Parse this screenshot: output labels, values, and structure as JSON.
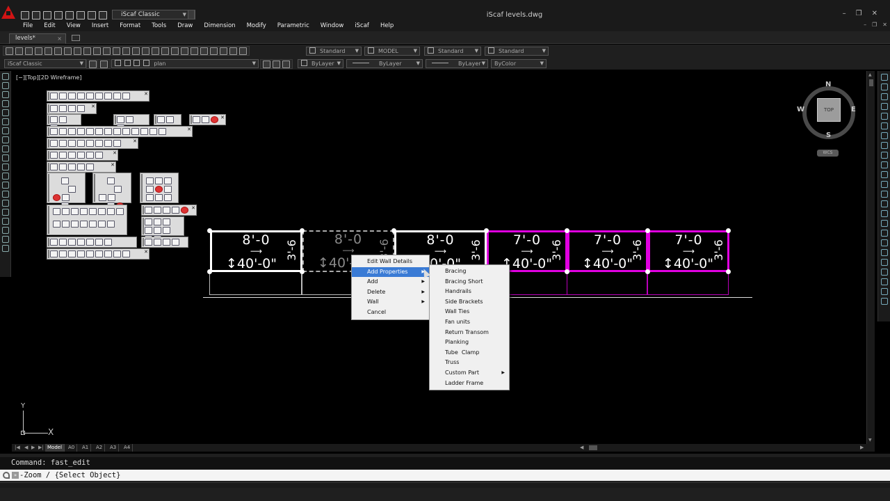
{
  "window": {
    "title": "iScaf   levels.dwg",
    "minimize": "–",
    "restore": "❐",
    "close": "✕"
  },
  "workspace": {
    "selected": "iScaf Classic"
  },
  "menu": [
    "File",
    "Edit",
    "View",
    "Insert",
    "Format",
    "Tools",
    "Draw",
    "Dimension",
    "Modify",
    "Parametric",
    "Window",
    "iScaf",
    "Help"
  ],
  "doc_controls": {
    "minimize": "–",
    "restore": "❐",
    "close": "✕"
  },
  "document_tab": {
    "label": "levels*",
    "close": "×"
  },
  "toolbar": {
    "text_style": "Standard",
    "dim_style": "MODEL",
    "table_style": "Standard",
    "multileader_style": "Standard",
    "workspace2": "iScaf Classic",
    "layer": "plan",
    "color": "ByLayer",
    "linetype": "ByLayer",
    "lineweight": "ByLayer",
    "plotstyle": "ByColor"
  },
  "viewport": {
    "label": "[−][Top][2D Wireframe]"
  },
  "viewcube": {
    "n": "N",
    "s": "S",
    "e": "E",
    "w": "W",
    "face": "TOP",
    "wcs": "WCS"
  },
  "ucs": {
    "x": "X",
    "y": "Y"
  },
  "drawing": {
    "panels": [
      {
        "height": "8'-0",
        "length": "40'-0\"",
        "lift": "3'-6"
      },
      {
        "height": "8'-0",
        "length": "40'-0\"",
        "lift": "3'-6"
      },
      {
        "height": "8'-0",
        "length": "40'-0\"",
        "lift": "3'-6"
      },
      {
        "height": "7'-0",
        "length": "40'-0\"",
        "lift": "3'-6"
      },
      {
        "height": "7'-0",
        "length": "40'-0\"",
        "lift": "3'-6"
      },
      {
        "height": "7'-0",
        "length": "40'-0\"",
        "lift": "3'-6"
      }
    ]
  },
  "context_menu": {
    "items": [
      {
        "label": "Edit Wall Details",
        "submenu": false
      },
      {
        "label": "Add Properties",
        "submenu": true,
        "highlighted": true
      },
      {
        "label": "Add",
        "submenu": true
      },
      {
        "label": "Delete",
        "submenu": true
      },
      {
        "label": "Wall",
        "submenu": true
      },
      {
        "label": "Cancel",
        "submenu": false
      }
    ]
  },
  "submenu": {
    "items": [
      {
        "label": "Bracing"
      },
      {
        "label": "Bracing Short"
      },
      {
        "label": "Handrails"
      },
      {
        "label": "Side Brackets"
      },
      {
        "label": "Wall Ties"
      },
      {
        "label": "Fan units"
      },
      {
        "label": "Return Transom"
      },
      {
        "label": "Planking"
      },
      {
        "label": "Tube  Clamp"
      },
      {
        "label": "Truss"
      },
      {
        "label": "Custom Part",
        "submenu": true
      },
      {
        "label": "Ladder Frame"
      }
    ]
  },
  "layout_tabs": [
    "Model",
    "A0",
    "A1",
    "A2",
    "A3",
    "A4"
  ],
  "command": {
    "history": "Command: fast_edit",
    "prompt": "-Zoom / {Select Object}"
  }
}
